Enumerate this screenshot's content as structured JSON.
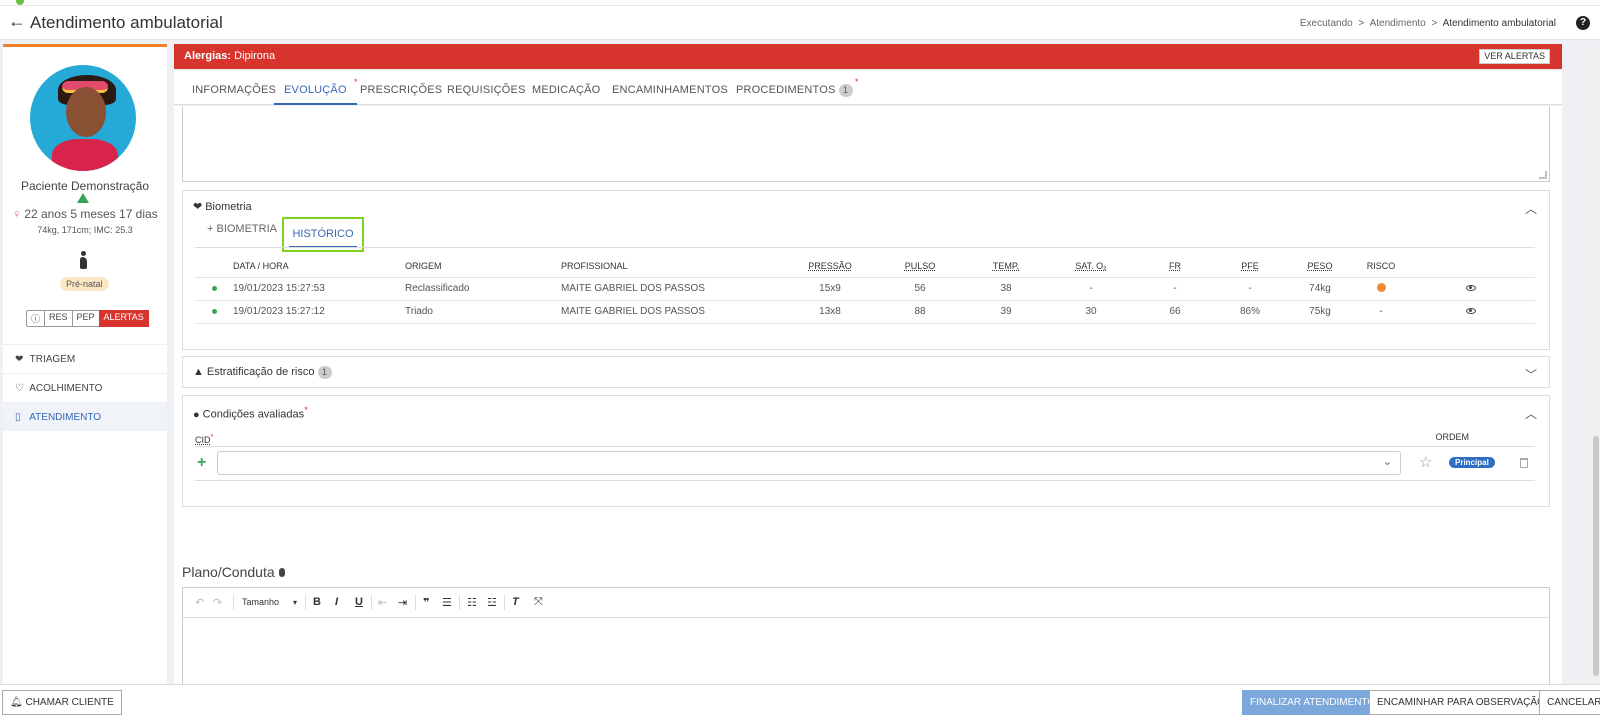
{
  "header": {
    "title": "Atendimento ambulatorial",
    "breadcrumb": [
      "Executando",
      "Atendimento",
      "Atendimento ambulatorial"
    ],
    "sep": ">"
  },
  "patient": {
    "name": "Paciente Demonstração",
    "age": "22 anos 5 meses 17 dias",
    "metrics": "74kg, 171cm; IMC: 25.3",
    "tag": "Pré-natal",
    "buttons": {
      "info": "ⓘ",
      "res": "RES",
      "pep": "PEP",
      "alertas": "ALERTAS"
    }
  },
  "nav": [
    {
      "label": "TRIAGEM",
      "icon": "heart-pulse-icon"
    },
    {
      "label": "ACOLHIMENTO",
      "icon": "heart-outline-icon"
    },
    {
      "label": "ATENDIMENTO",
      "icon": "clipboard-icon",
      "active": true
    }
  ],
  "allergy": {
    "label": "Alergias:",
    "value": "Dipirona",
    "button": "VER ALERTAS"
  },
  "tabs": {
    "informacoes": "INFORMAÇÕES",
    "evolucao": "EVOLUÇÃO",
    "prescricoes": "PRESCRIÇÕES",
    "requisicoes": "REQUISIÇÕES",
    "medicacao": "MEDICAÇÃO",
    "encaminhamentos": "ENCAMINHAMENTOS",
    "procedimentos": "PROCEDIMENTOS",
    "procedimentos_count": "1",
    "required": "*"
  },
  "biometria": {
    "title": "Biometria",
    "add_tab": "+ BIOMETRIA",
    "hist_tab": "HISTÓRICO",
    "columns": {
      "data": "DATA / HORA",
      "origem": "ORIGEM",
      "profissional": "PROFISSIONAL",
      "pressao": "PRESSÃO",
      "pulso": "PULSO",
      "temp": "TEMP.",
      "sat": "SAT. O₂",
      "fr": "FR",
      "pfe": "PFE",
      "peso": "PESO",
      "risco": "RISCO"
    },
    "rows": [
      {
        "data": "19/01/2023 15:27:53",
        "origem": "Reclassificado",
        "profissional": "MAITE GABRIEL DOS PASSOS",
        "pressao": "15x9",
        "pulso": "56",
        "temp": "38",
        "sat": "-",
        "fr": "-",
        "pfe": "-",
        "peso": "74kg",
        "risco": "orange"
      },
      {
        "data": "19/01/2023 15:27:12",
        "origem": "Triado",
        "profissional": "MAITE GABRIEL DOS PASSOS",
        "pressao": "13x8",
        "pulso": "88",
        "temp": "39",
        "sat": "30",
        "fr": "66",
        "pfe": "86%",
        "peso": "75kg",
        "risco": "-"
      }
    ]
  },
  "estratificacao": {
    "title": "Estratificação de risco",
    "count": "1"
  },
  "condicoes": {
    "title": "Condições avaliadas",
    "cid_label": "CID",
    "ordem_label": "ORDEM",
    "principal": "Principal"
  },
  "plano": {
    "title": "Plano/Conduta",
    "toolbar": {
      "size": "Tamanho"
    }
  },
  "footer": {
    "chamar": "CHAMAR CLIENTE",
    "finalizar": "FINALIZAR ATENDIMENTO",
    "encaminhar": "ENCAMINHAR PARA OBSERVAÇÃO",
    "cancelar": "CANCELAR"
  },
  "colors": {
    "accent": "#3867b8",
    "alert": "#d6342c",
    "highlight": "#7ed321",
    "risk_orange": "#ef8a32",
    "primary_button": "#7ba7db"
  }
}
